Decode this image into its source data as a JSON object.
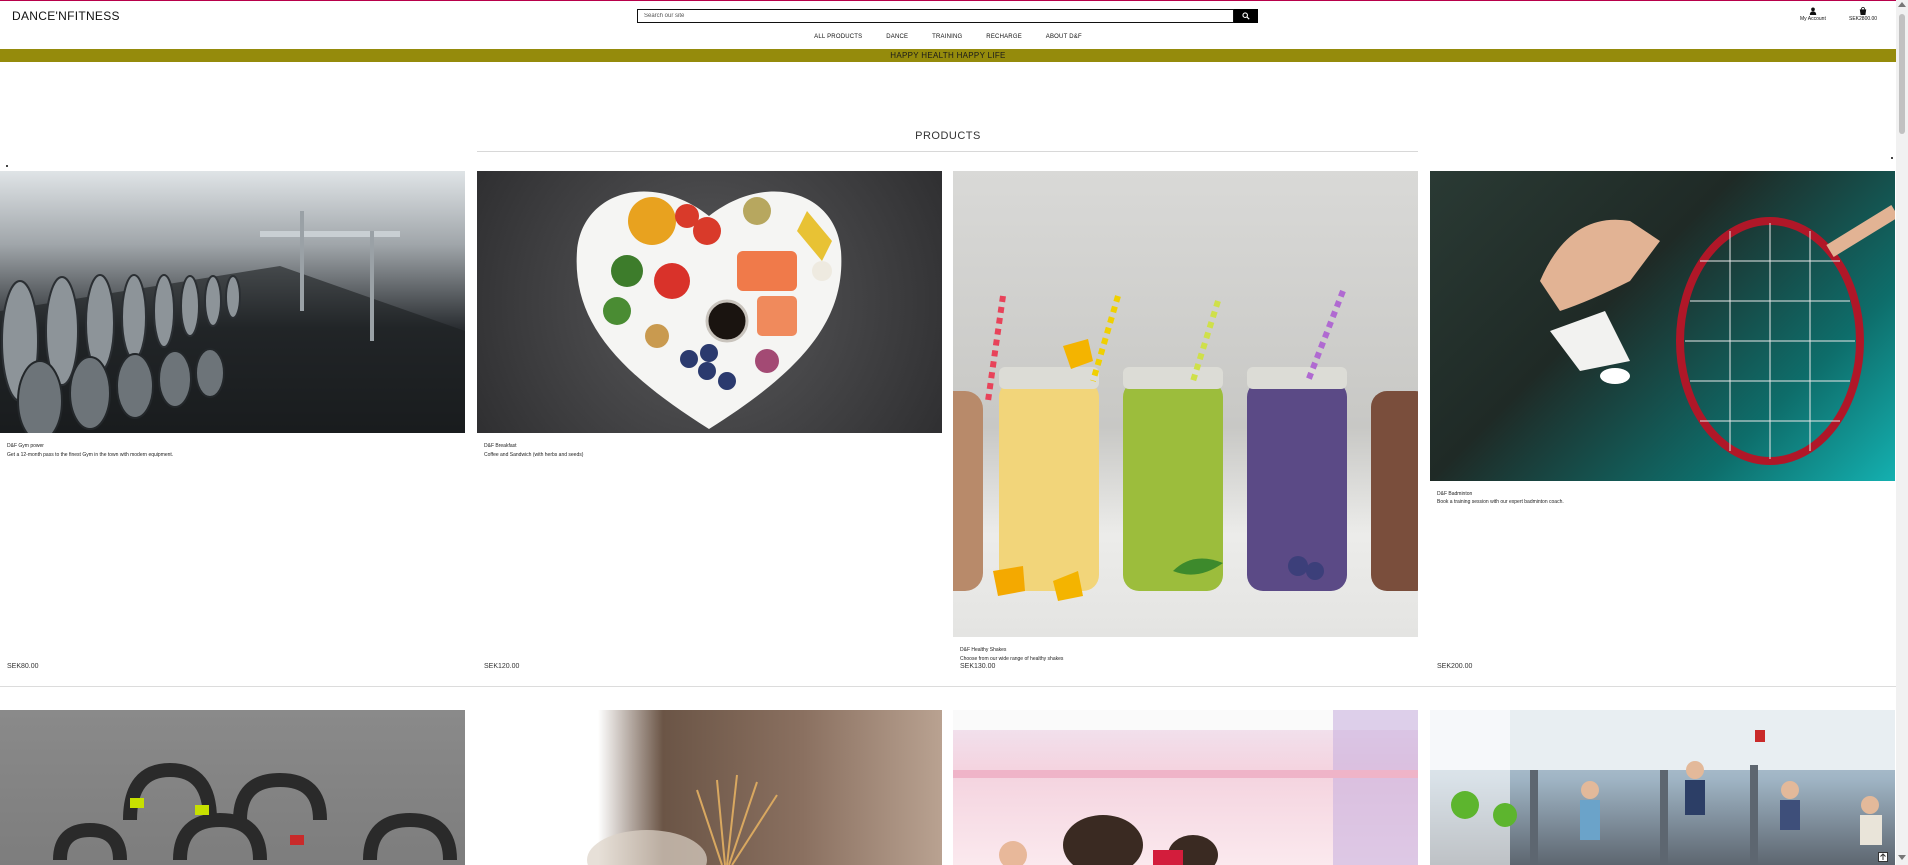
{
  "header": {
    "logo": "DANCE'NFITNESS",
    "search_placeholder": "Search our site",
    "account_label": "My Account",
    "bag_total": "SEK2800.00"
  },
  "nav": {
    "items": [
      "ALL PRODUCTS",
      "DANCE",
      "TRAINING",
      "RECHARGE",
      "ABOUT D&F"
    ]
  },
  "banner": {
    "text": "HAPPY HEALTH HAPPY LIFE"
  },
  "products": {
    "title": "PRODUCTS",
    "items": [
      {
        "name": "D&F Gym power",
        "description": "Get a 12-month pass to the finest Gym in the town with modern equipment.",
        "price": "SEK80.00",
        "image": "gym-dumbbells-photo"
      },
      {
        "name": "D&F Breakfast",
        "description": "Coffee and Sandwich (with herbs and seeds)",
        "price": "SEK120.00",
        "image": "heart-plate-food-photo"
      },
      {
        "name": "D&F Healthy Shakes",
        "description": "Choose from our wide range of healthy shakes",
        "price": "SEK130.00",
        "image": "smoothie-jars-photo"
      },
      {
        "name": "D&F Badminton",
        "description": "Book a training session with our expert badminton coach.",
        "price": "SEK200.00",
        "image": "badminton-shuttlecock-photo"
      },
      {
        "image": "kettlebells-photo"
      },
      {
        "image": "incense-sticks-photo"
      },
      {
        "image": "dance-class-photo"
      },
      {
        "image": "gym-machines-photo"
      }
    ]
  },
  "colors": {
    "banner_bg": "#958b0c",
    "accent_line": "#b8004a",
    "search_button": "#000000"
  },
  "icons": [
    "search-icon",
    "user-icon",
    "shopping-bag-icon",
    "arrow-up-icon"
  ]
}
